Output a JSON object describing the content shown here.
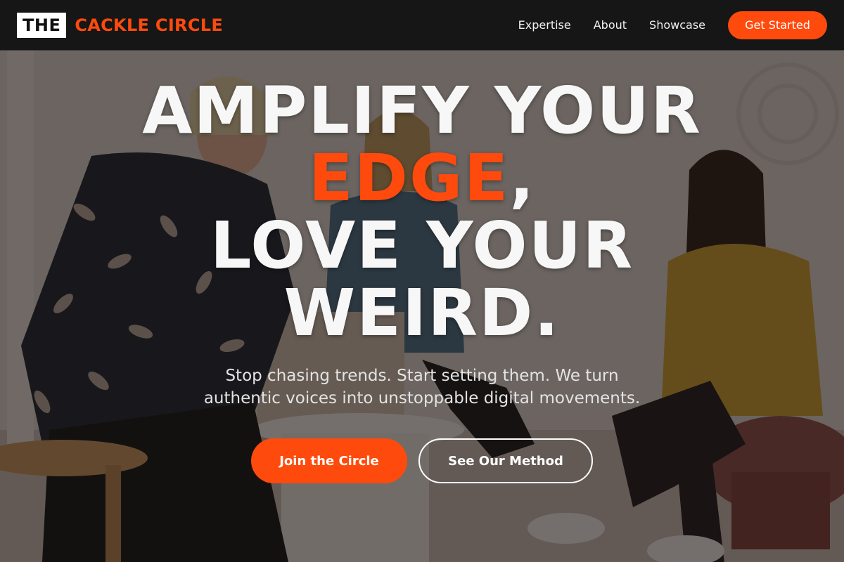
{
  "brand": {
    "logo_box": "THE",
    "logo_text": "CACKLE CIRCLE",
    "accent_color": "#ff4a0d"
  },
  "nav": {
    "links": [
      "Expertise",
      "About",
      "Showcase"
    ],
    "cta": "Get Started"
  },
  "hero": {
    "headline_line1": "AMPLIFY YOUR",
    "headline_accent": "EDGE",
    "headline_comma": ",",
    "headline_line3": "LOVE YOUR",
    "headline_line4": "WEIRD.",
    "subtitle_line1": "Stop chasing trends. Start setting them. We turn",
    "subtitle_line2": "authentic voices into unstoppable digital movements.",
    "primary_button": "Join the Circle",
    "secondary_button": "See Our Method",
    "background_image": "people-meeting-photo"
  }
}
